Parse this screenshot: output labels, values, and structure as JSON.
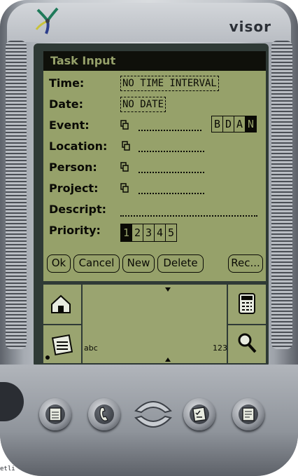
{
  "device": {
    "brand": "visor"
  },
  "screen": {
    "title": "Task Input",
    "fields": {
      "time_label": "Time:",
      "time_value": "NO TIME INTERVAL",
      "date_label": "Date:",
      "date_value": "NO DATE",
      "event_label": "Event:",
      "event_flags": [
        "B",
        "D",
        "A",
        "N"
      ],
      "event_flag_selected": "N",
      "location_label": "Location:",
      "person_label": "Person:",
      "project_label": "Project:",
      "descript_label": "Descript:",
      "priority_label": "Priority:",
      "priority_options": [
        "1",
        "2",
        "3",
        "4",
        "5"
      ],
      "priority_selected": "1"
    },
    "buttons": {
      "ok": "Ok",
      "cancel": "Cancel",
      "new": "New",
      "delete": "Delete",
      "rec": "Rec..."
    }
  },
  "silkscreen": {
    "left_graffiti": "abc",
    "right_graffiti": "123"
  },
  "hardware_buttons": [
    "date-book",
    "address",
    "scroll",
    "to-do",
    "memo"
  ],
  "corner_text": "etli"
}
